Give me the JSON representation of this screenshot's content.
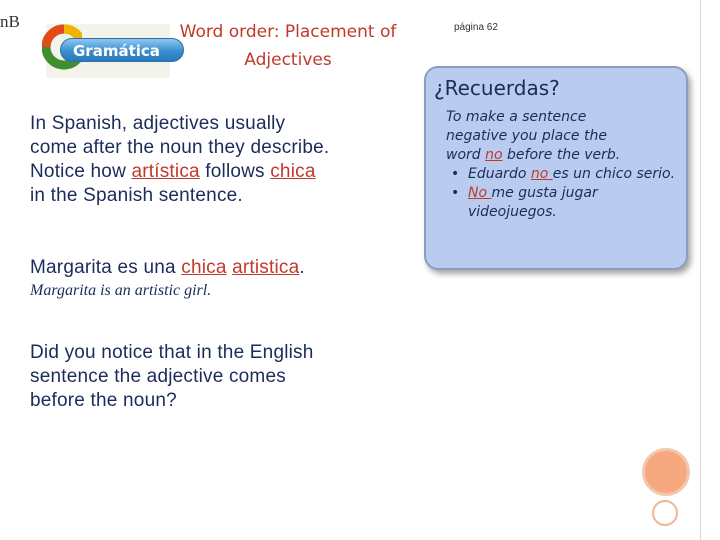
{
  "corner_tag": "nB",
  "logo": {
    "label": "Gramática"
  },
  "title": {
    "line1": "Word order: Placement of",
    "line2": "Adjectives"
  },
  "page_ref": "página 62",
  "para1": {
    "line1": "In Spanish, adjectives usually",
    "line2": "come after the noun they describe.",
    "line3_prefix": "Notice how ",
    "line3_adj": "artística",
    "line3_mid": " follows ",
    "line3_noun": "chica",
    "line4": "in the Spanish sentence."
  },
  "example": {
    "prefix": "Margarita es una ",
    "noun": "chica",
    "space": " ",
    "adj": "artistica",
    "suffix": "."
  },
  "translation": "Margarita is an artistic girl.",
  "para2": {
    "line1": "Did you notice that in the English",
    "line2": "sentence the adjective comes",
    "line3": "before the noun?"
  },
  "callout": {
    "title": "¿Recuerdas?",
    "intro1": "To make a sentence",
    "intro2": "negative you place the",
    "intro3_prefix": "word ",
    "intro3_word": "no",
    "intro3_suffix": " before the verb.",
    "bullet_char": "•",
    "b1_prefix": "Eduardo ",
    "b1_word": "no ",
    "b1_suffix": "es un chico serio.",
    "b2_word": "No ",
    "b2_suffix": "me gusta jugar videojuegos."
  },
  "colors": {
    "title_red": "#c0392b",
    "body_navy": "#1c2c5a",
    "callout_bg": "#b9ccf0",
    "accent_orange": "#f6a97f"
  }
}
